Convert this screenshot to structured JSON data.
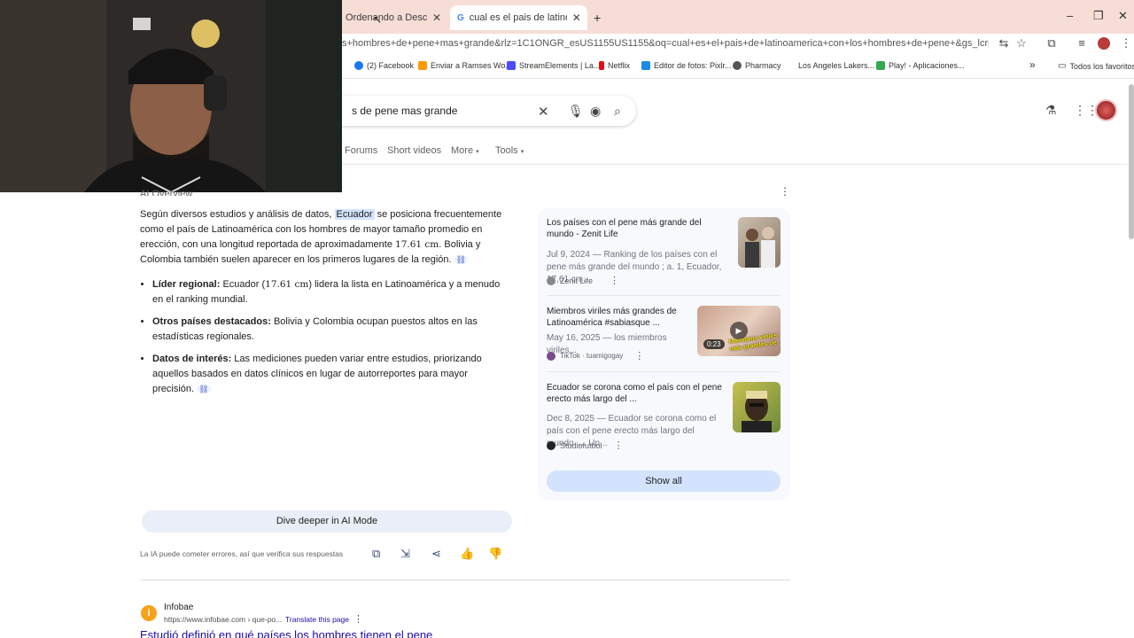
{
  "browser": {
    "tabs": [
      {
        "label": "Ordenando a Desconocid",
        "active": false
      },
      {
        "label": "cual es el pais de latinoamerica",
        "active": true
      }
    ],
    "new_tab": "+",
    "address": "s+hombres+de+pene+mas+grande&rlz=1C1ONGR_esUS1155US1155&oq=cual+es+el+pais+de+latinoamerica+con+los+hombres+de+pene+&gs_lcrp=EgZjaHJvbWUqBwgB...",
    "bookmarks": [
      "(2) Facebook",
      "Enviar a Ramses Wo...",
      "StreamElements | La...",
      "Netflix",
      "Editor de fotos: Pixlr...",
      "Pharmacy",
      "Los Angeles Lakers...",
      "Play! - Aplicaciones...",
      "Todos los favoritos"
    ],
    "bookmarks_more": "»",
    "window_controls": [
      "–",
      "❐",
      "✕"
    ]
  },
  "search": {
    "query": "s de pene mas grande",
    "tabs": [
      "Forums",
      "Short videos",
      "More",
      "Tools"
    ]
  },
  "overview": {
    "partial_header": "AI Overview",
    "p1_a": "Según diversos estudios y análisis de datos, ",
    "p1_hl": "Ecuador",
    "p1_b": " se posiciona frecuentemente como el país de Latinoamérica con los hombres de mayor tamaño promedio en erección, con una longitud reportada de aproximadamente ",
    "p1_num": "17.61 cm",
    "p1_c": ". Bolivia y Colombia también suelen aparecer en los primeros lugares de la región.",
    "bullets": [
      {
        "bold": "Líder regional:",
        "pre": " Ecuador (",
        "num": "17.61 cm",
        "post": ") lidera la lista en Latinoamérica y a menudo en el ranking mundial."
      },
      {
        "bold": "Otros países destacados:",
        "pre": " Bolivia y Colombia ocupan puestos altos en las estadísticas regionales.",
        "num": "",
        "post": ""
      },
      {
        "bold": "Datos de interés:",
        "pre": " Las mediciones pueden variar entre estudios, priorizando aquellos basados en datos clínicos en lugar de autorreportes para mayor precisión.",
        "num": "",
        "post": ""
      }
    ],
    "dive_deeper": "Dive deeper in AI Mode",
    "disclaimer": "La IA puede cometer errores, así que verifica sus respuestas"
  },
  "sources": {
    "items": [
      {
        "title": "Los países con el pene más grande del mundo - Zenit Life",
        "snippet": "Jul 9, 2024 — Ranking de los países con el pene más grande del mundo ; a. 1, Ecuador, 17,61 cm...",
        "site": "Zenit Life"
      },
      {
        "title": "Miembros viriles más grandes de Latinoamérica #sabiasque ...",
        "snippet": "May 16, 2025 — los miembros viriles...",
        "site": "TikTok · tuamigogay",
        "duration": "0:23",
        "thumb_text": "Miembros viriles más grandes de"
      },
      {
        "title": "Ecuador se corona como el país con el pene erecto más largo del ...",
        "snippet": "Dec 8, 2025 — Ecuador se corona como el país con el pene erecto más largo del mundo. ... Un...",
        "site": "Studiofutbol"
      }
    ],
    "show_all": "Show all"
  },
  "result": {
    "site": "Infobae",
    "url": "https://www.infobae.com › que-po...",
    "translate": "Translate this page",
    "title": "Estudió definió en qué países los hombres tienen el pene"
  },
  "colors": {
    "accent": "#1a0dab",
    "chip": "#d3e3fd",
    "titlebar": "#f6ddd6"
  }
}
